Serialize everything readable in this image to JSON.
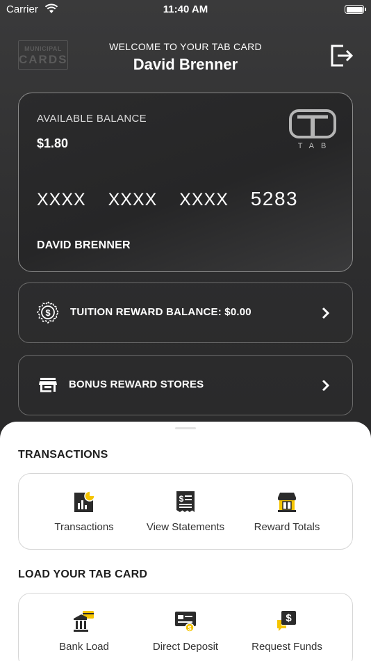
{
  "status_bar": {
    "carrier": "Carrier",
    "time": "11:40 AM"
  },
  "header": {
    "logo_line1": "MUNICIPAL",
    "logo_line2": "CARDS",
    "welcome": "WELCOME TO YOUR TAB CARD",
    "user_name": "David Brenner"
  },
  "card": {
    "balance_label": "AVAILABLE BALANCE",
    "balance_value": "$1.80",
    "number_masked": "XXXX  XXXX  XXXX",
    "number_last4": "5283",
    "holder_name": "DAVID BRENNER",
    "brand": "TAB"
  },
  "rows": [
    {
      "label": "TUITION REWARD BALANCE: $0.00",
      "icon": "dollar-badge-icon"
    },
    {
      "label": "BONUS REWARD STORES",
      "icon": "store-icon"
    }
  ],
  "transactions": {
    "title": "TRANSACTIONS",
    "items": [
      {
        "label": "Transactions",
        "icon": "chart-icon"
      },
      {
        "label": "View Statements",
        "icon": "statement-icon"
      },
      {
        "label": "Reward Totals",
        "icon": "reward-store-icon"
      }
    ]
  },
  "load": {
    "title": "LOAD YOUR TAB CARD",
    "items": [
      {
        "label": "Bank Load",
        "icon": "bank-icon"
      },
      {
        "label": "Direct Deposit",
        "icon": "direct-deposit-icon"
      },
      {
        "label": "Request Funds",
        "icon": "request-funds-icon"
      }
    ]
  },
  "colors": {
    "accent": "#f5c400",
    "dark": "#2a2a2b",
    "icon_dark": "#2b2b2b"
  }
}
